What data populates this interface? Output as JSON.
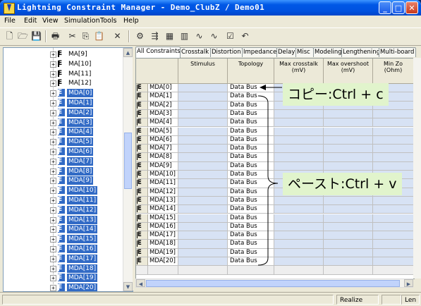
{
  "window": {
    "title": "Lightning Constraint Manager - Demo_ClubZ / Demo01",
    "minimize": "_",
    "maximize": "□",
    "close": "✕"
  },
  "menu": [
    "File",
    "Edit",
    "View",
    "Simulation",
    "Tools",
    "Help"
  ],
  "toolbar": {
    "icons": [
      "new-file-icon",
      "open-folder-icon",
      "save-icon",
      "print-icon",
      "cut-icon",
      "copy-icon",
      "paste-icon",
      "delete-icon",
      "net-icon",
      "route-icon",
      "grid-icon",
      "chart-icon",
      "waveform-icon",
      "waveform-alt-icon",
      "check-icon",
      "undo-icon"
    ],
    "glyphs": [
      "🗋",
      "🗁",
      "💾",
      "🖶",
      "✂",
      "⎘",
      "📋",
      "✕",
      "⚙",
      "⇶",
      "▦",
      "▥",
      "∿",
      "∿",
      "☑",
      "↶"
    ]
  },
  "tree": {
    "items": [
      {
        "label": "MA[9]",
        "selected": false
      },
      {
        "label": "MA[10]",
        "selected": false
      },
      {
        "label": "MA[11]",
        "selected": false
      },
      {
        "label": "MA[12]",
        "selected": false
      },
      {
        "label": "MDA[0]",
        "selected": true,
        "focus": true
      },
      {
        "label": "MDA[1]",
        "selected": true
      },
      {
        "label": "MDA[2]",
        "selected": true
      },
      {
        "label": "MDA[3]",
        "selected": true
      },
      {
        "label": "MDA[4]",
        "selected": true
      },
      {
        "label": "MDA[5]",
        "selected": true
      },
      {
        "label": "MDA[6]",
        "selected": true
      },
      {
        "label": "MDA[7]",
        "selected": true
      },
      {
        "label": "MDA[8]",
        "selected": true
      },
      {
        "label": "MDA[9]",
        "selected": true
      },
      {
        "label": "MDA[10]",
        "selected": true
      },
      {
        "label": "MDA[11]",
        "selected": true
      },
      {
        "label": "MDA[12]",
        "selected": true
      },
      {
        "label": "MDA[13]",
        "selected": true
      },
      {
        "label": "MDA[14]",
        "selected": true
      },
      {
        "label": "MDA[15]",
        "selected": true
      },
      {
        "label": "MDA[16]",
        "selected": true
      },
      {
        "label": "MDA[17]",
        "selected": true
      },
      {
        "label": "MDA[18]",
        "selected": true
      },
      {
        "label": "MDA[19]",
        "selected": true
      },
      {
        "label": "MDA[20]",
        "selected": true
      }
    ],
    "expander": "+",
    "item_icon": "E"
  },
  "tabs": [
    "All Constraints",
    "Crosstalk",
    "Distortion",
    "Impedance",
    "Delay",
    "Misc",
    "Modeling",
    "Lengthening",
    "Multi-board"
  ],
  "grid": {
    "columns": [
      "Stimulus",
      "Topology",
      "Max crosstalk\n(mV)",
      "Max overshoot\n(mV)",
      "Min Zo\n(Ohm)"
    ],
    "row_icon": "E",
    "rows": [
      {
        "name": "MDA[0]",
        "topology": "Data Bus"
      },
      {
        "name": "MDA[1]",
        "topology": "Data Bus"
      },
      {
        "name": "MDA[2]",
        "topology": "Data Bus"
      },
      {
        "name": "MDA[3]",
        "topology": "Data Bus"
      },
      {
        "name": "MDA[4]",
        "topology": "Data Bus"
      },
      {
        "name": "MDA[5]",
        "topology": "Data Bus"
      },
      {
        "name": "MDA[6]",
        "topology": "Data Bus"
      },
      {
        "name": "MDA[7]",
        "topology": "Data Bus"
      },
      {
        "name": "MDA[8]",
        "topology": "Data Bus"
      },
      {
        "name": "MDA[9]",
        "topology": "Data Bus"
      },
      {
        "name": "MDA[10]",
        "topology": "Data Bus"
      },
      {
        "name": "MDA[11]",
        "topology": "Data Bus"
      },
      {
        "name": "MDA[12]",
        "topology": "Data Bus"
      },
      {
        "name": "MDA[13]",
        "topology": "Data Bus"
      },
      {
        "name": "MDA[14]",
        "topology": "Data Bus"
      },
      {
        "name": "MDA[15]",
        "topology": "Data Bus"
      },
      {
        "name": "MDA[16]",
        "topology": "Data Bus"
      },
      {
        "name": "MDA[17]",
        "topology": "Data Bus"
      },
      {
        "name": "MDA[18]",
        "topology": "Data Bus"
      },
      {
        "name": "MDA[19]",
        "topology": "Data Bus"
      },
      {
        "name": "MDA[20]",
        "topology": "Data Bus"
      }
    ]
  },
  "annotations": {
    "copy": "コピー:Ctrl + c",
    "paste": "ペースト:Ctrl + v"
  },
  "statusbar": {
    "realize": "Realize",
    "len": "Len"
  },
  "colors": {
    "selection": "#316ac5",
    "callout_bg": "#e1f4cc"
  }
}
